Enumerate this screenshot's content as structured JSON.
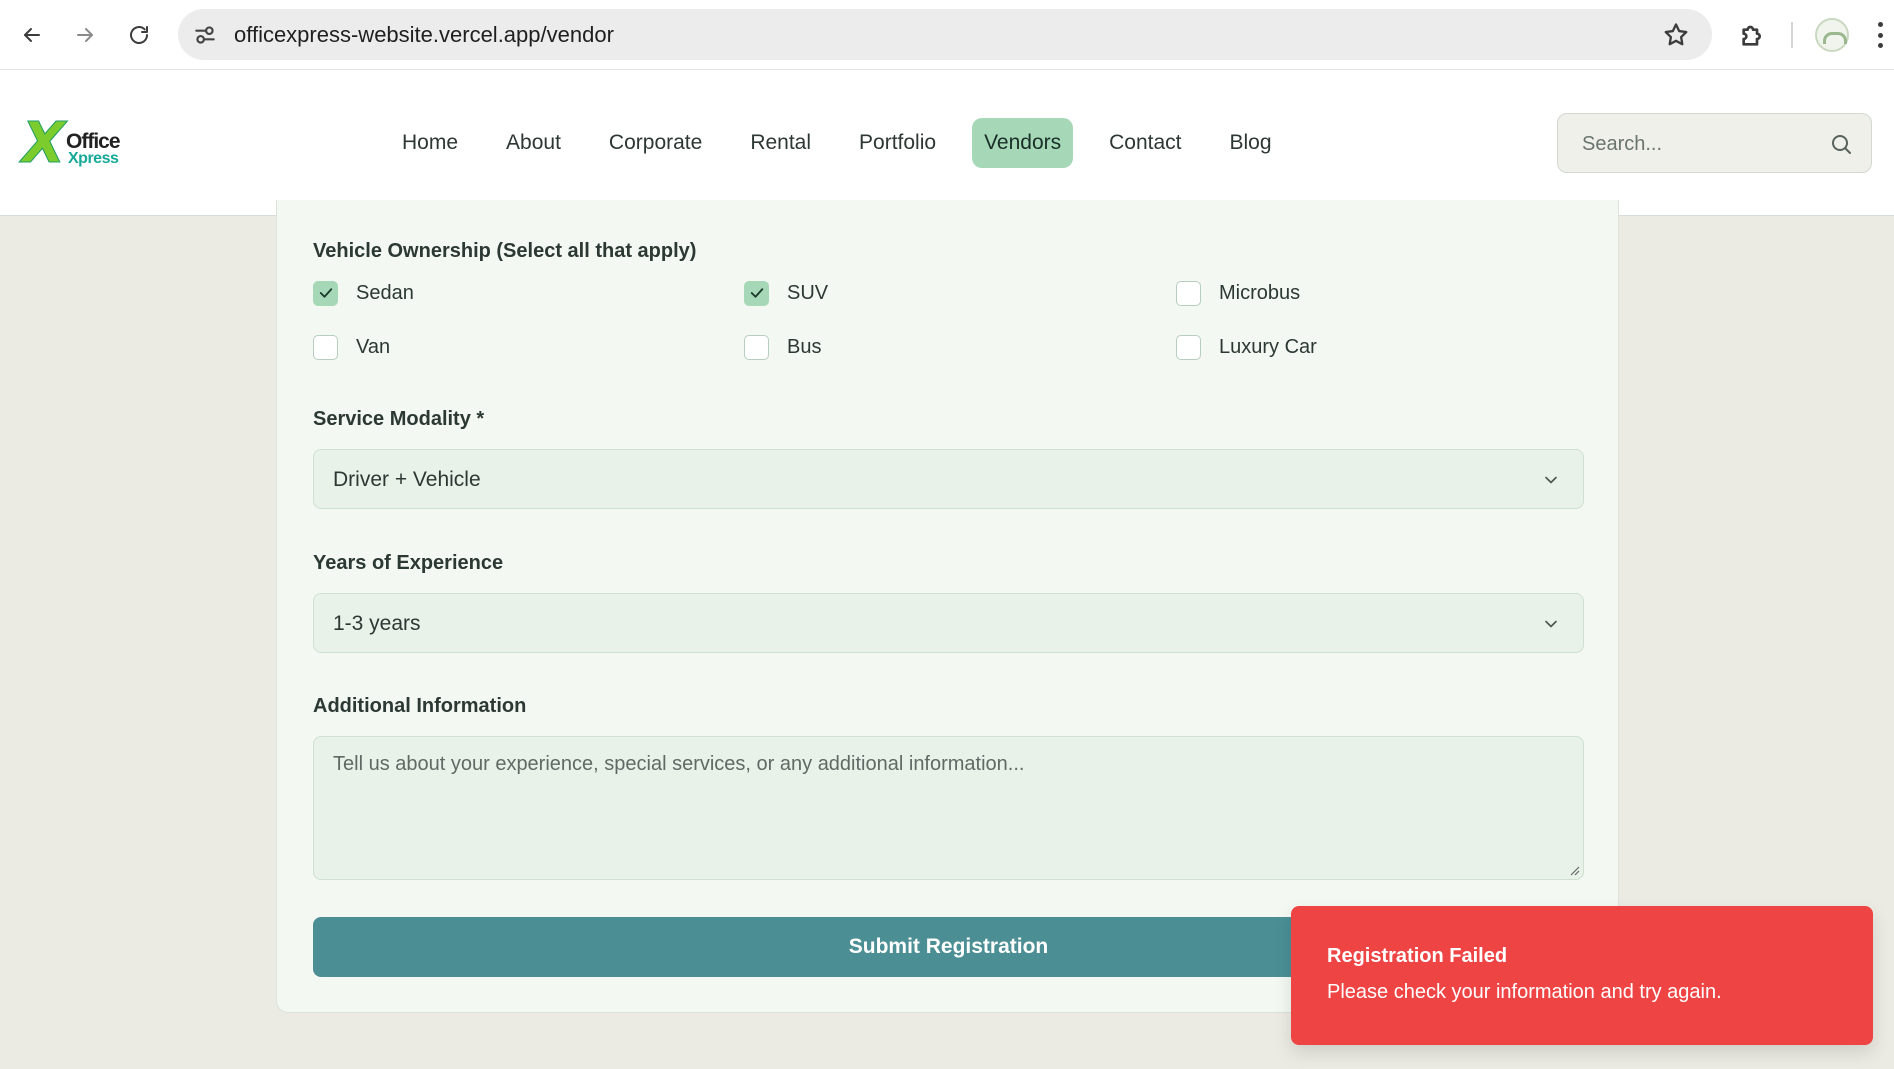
{
  "browser": {
    "url": "officexpress-website.vercel.app/vendor"
  },
  "header": {
    "logo_mark": "X",
    "logo_top": "Office",
    "logo_bottom": "Xpress",
    "nav": [
      {
        "label": "Home",
        "active": false
      },
      {
        "label": "About",
        "active": false
      },
      {
        "label": "Corporate",
        "active": false
      },
      {
        "label": "Rental",
        "active": false
      },
      {
        "label": "Portfolio",
        "active": false
      },
      {
        "label": "Vendors",
        "active": true
      },
      {
        "label": "Contact",
        "active": false
      },
      {
        "label": "Blog",
        "active": false
      }
    ],
    "search_placeholder": "Search..."
  },
  "form": {
    "vehicle_ownership_label": "Vehicle Ownership (Select all that apply)",
    "vehicles": [
      {
        "label": "Sedan",
        "checked": true
      },
      {
        "label": "SUV",
        "checked": true
      },
      {
        "label": "Microbus",
        "checked": false
      },
      {
        "label": "Van",
        "checked": false
      },
      {
        "label": "Bus",
        "checked": false
      },
      {
        "label": "Luxury Car",
        "checked": false
      }
    ],
    "service_modality_label": "Service Modality *",
    "service_modality_value": "Driver + Vehicle",
    "experience_label": "Years of Experience",
    "experience_value": "1-3 years",
    "additional_label": "Additional Information",
    "additional_placeholder": "Tell us about your experience, special services, or any additional information...",
    "submit_label": "Submit Registration"
  },
  "toast": {
    "title": "Registration Failed",
    "message": "Please check your information and try again."
  },
  "colors": {
    "accent": "#a6d8b8",
    "submit": "#4b8f95",
    "error": "#ef4444"
  }
}
